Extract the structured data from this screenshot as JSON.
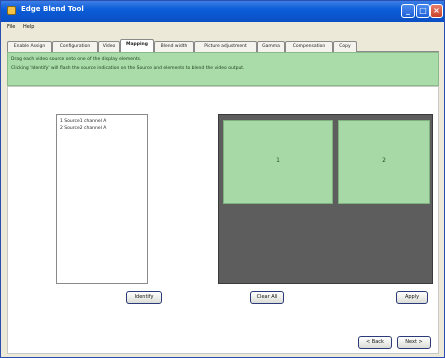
{
  "window": {
    "title": "Edge Blend Tool",
    "controls": {
      "minimize": "_",
      "maximize": "□",
      "close": "×"
    }
  },
  "menu": {
    "items": [
      {
        "label": "File"
      },
      {
        "label": "Help"
      }
    ]
  },
  "tabs": [
    {
      "label": "Enable Assign"
    },
    {
      "label": "Configuration"
    },
    {
      "label": "Video"
    },
    {
      "label": "Mapping",
      "active": true
    },
    {
      "label": "Blend width"
    },
    {
      "label": "Picture adjustment"
    },
    {
      "label": "Gamma"
    },
    {
      "label": "Compensation"
    },
    {
      "label": "Copy"
    }
  ],
  "instructions": {
    "line1": "Drag each video source onto one of the display elements.",
    "line2": "Clicking 'Identify' will flash the source indication on the Source and elements to blend the video output."
  },
  "sources": {
    "items": [
      {
        "label": "1  Source1 channel A"
      },
      {
        "label": "2  Source2 channel A"
      }
    ]
  },
  "preview": {
    "cells": [
      {
        "label": "1"
      },
      {
        "label": "2"
      }
    ]
  },
  "buttons": {
    "identify": "Identify",
    "clear_all": "Clear All",
    "apply": "Apply",
    "back": "< Back",
    "next": "Next >"
  }
}
